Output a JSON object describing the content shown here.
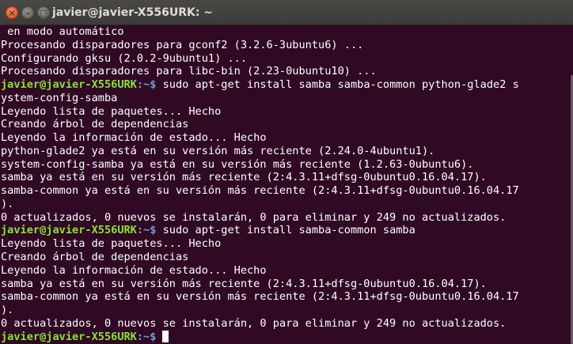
{
  "window": {
    "title": "javier@javier-X556URK: ~",
    "controls": {
      "close": "×",
      "minimize": "–",
      "maximize": "□"
    }
  },
  "terminal": {
    "prompt_user_host": "javier@javier-X556URK",
    "prompt_path": ":~$",
    "lines": [
      " en modo automático",
      "Procesando disparadores para gconf2 (3.2.6-3ubuntu6) ...",
      "Configurando gksu (2.0.2-9ubuntu1) ...",
      "Procesando disparadores para libc-bin (2.23-0ubuntu10) ...",
      " sudo apt-get install samba samba-common python-glade2 s",
      "ystem-config-samba",
      "Leyendo lista de paquetes... Hecho",
      "Creando árbol de dependencias",
      "Leyendo la información de estado... Hecho",
      "python-glade2 ya está en su versión más reciente (2.24.0-4ubuntu1).",
      "system-config-samba ya está en su versión más reciente (1.2.63-0ubuntu6).",
      "samba ya está en su versión más reciente (2:4.3.11+dfsg-0ubuntu0.16.04.17).",
      "samba-common ya está en su versión más reciente (2:4.3.11+dfsg-0ubuntu0.16.04.17",
      ").",
      "0 actualizados, 0 nuevos se instalarán, 0 para eliminar y 249 no actualizados.",
      " sudo apt-get install samba-common samba",
      "Leyendo lista de paquetes... Hecho",
      "Creando árbol de dependencias",
      "Leyendo la información de estado... Hecho",
      "samba ya está en su versión más reciente (2:4.3.11+dfsg-0ubuntu0.16.04.17).",
      "samba-common ya está en su versión más reciente (2:4.3.11+dfsg-0ubuntu0.16.04.17",
      ").",
      "0 actualizados, 0 nuevos se instalarán, 0 para eliminar y 249 no actualizados.",
      ""
    ]
  },
  "colors": {
    "background": "#300a24",
    "text": "#ffffff",
    "prompt_user": "#8ae234",
    "prompt_path": "#729fcf",
    "titlebar": "#3c3b37"
  }
}
